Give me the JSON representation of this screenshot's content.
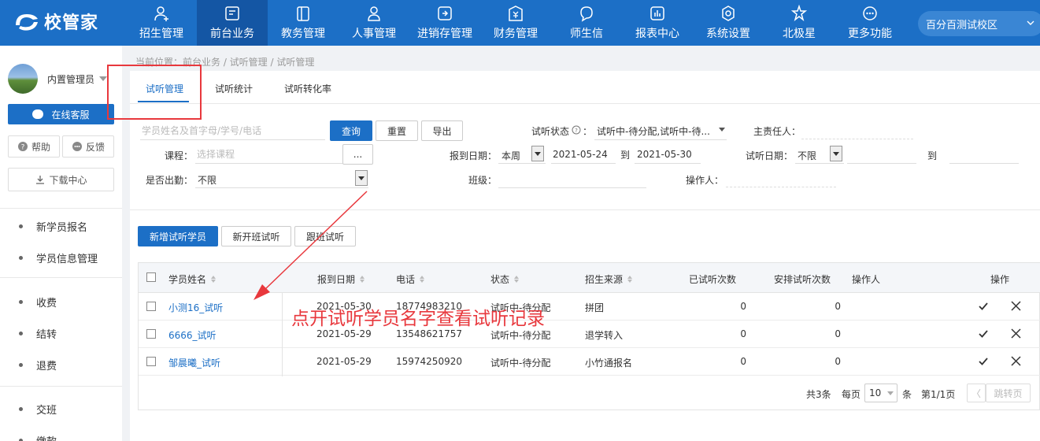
{
  "app": {
    "logo_text": "校管家",
    "campus": "百分百测试校区"
  },
  "nav": [
    {
      "label": "招生管理",
      "icon": "person-add-icon"
    },
    {
      "label": "前台业务",
      "icon": "monitor-icon",
      "active": true
    },
    {
      "label": "教务管理",
      "icon": "book-icon"
    },
    {
      "label": "人事管理",
      "icon": "person-icon"
    },
    {
      "label": "进销存管理",
      "icon": "inventory-icon"
    },
    {
      "label": "财务管理",
      "icon": "finance-icon"
    },
    {
      "label": "师生信",
      "icon": "chat-icon"
    },
    {
      "label": "报表中心",
      "icon": "chart-icon"
    },
    {
      "label": "系统设置",
      "icon": "gear-icon"
    },
    {
      "label": "北极星",
      "icon": "star-icon"
    },
    {
      "label": "更多功能",
      "icon": "more-icon"
    }
  ],
  "sidebar": {
    "user_name": "内置管理员",
    "service_label": "在线客服",
    "help_label": "帮助",
    "feedback_label": "反馈",
    "download_label": "下载中心",
    "groups": [
      [
        "新学员报名",
        "学员信息管理"
      ],
      [
        "收费",
        "结转",
        "退费"
      ],
      [
        "交班",
        "缴款"
      ]
    ]
  },
  "breadcrumb": "当前位置：前台业务 / 试听管理 / 试听管理",
  "tabs": [
    {
      "label": "试听管理",
      "active": true
    },
    {
      "label": "试听统计"
    },
    {
      "label": "试听转化率"
    }
  ],
  "filters": {
    "search_placeholder": "学员姓名及首字母/学号/电话",
    "query_label": "查询",
    "reset_label": "重置",
    "export_label": "导出",
    "status_label": "试听状态",
    "status_value": "试听中-待分配,试听中-待...",
    "owner_label": "主责任人：",
    "course_label": "课程：",
    "course_placeholder": "选择课程",
    "course_btn": "...",
    "report_date_label": "报到日期：",
    "report_period": "本周",
    "date_from": "2021-05-24",
    "to_label": "到",
    "date_to": "2021-05-30",
    "trial_date_label": "试听日期：",
    "trial_period": "不限",
    "trial_to_label": "到",
    "attend_label": "是否出勤：",
    "attend_value": "不限",
    "class_label": "班级：",
    "operator_label": "操作人："
  },
  "actions": {
    "add_label": "新增试听学员",
    "new_class_label": "新开班试听",
    "follow_label": "跟班试听"
  },
  "table": {
    "headers": {
      "name": "学员姓名",
      "date": "报到日期",
      "phone": "电话",
      "status": "状态",
      "source": "招生来源",
      "tried": "已试听次数",
      "arranged": "安排试听次数",
      "operator": "操作人",
      "ops": "操作"
    },
    "rows": [
      {
        "name": "小测16_试听",
        "date": "2021-05-30",
        "phone": "18774983210",
        "status": "试听中-待分配",
        "source": "拼团",
        "tried": "0",
        "arranged": "0"
      },
      {
        "name": "6666_试听",
        "date": "2021-05-29",
        "phone": "13548621757",
        "status": "试听中-待分配",
        "source": "退学转入",
        "tried": "0",
        "arranged": "0"
      },
      {
        "name": "邹晨曦_试听",
        "date": "2021-05-29",
        "phone": "15974250920",
        "status": "试听中-待分配",
        "source": "小竹通报名",
        "tried": "0",
        "arranged": "0"
      }
    ],
    "pager": {
      "total": "共3条",
      "per_page_label": "每页",
      "per_page": "10",
      "unit": "条",
      "page": "第1/1页",
      "prev": "〈",
      "jump": "跳转页"
    }
  },
  "annotation": "点开试听学员名字查看试听记录",
  "colors": {
    "brand": "#1c6fc6",
    "annotation": "#e8383d"
  }
}
